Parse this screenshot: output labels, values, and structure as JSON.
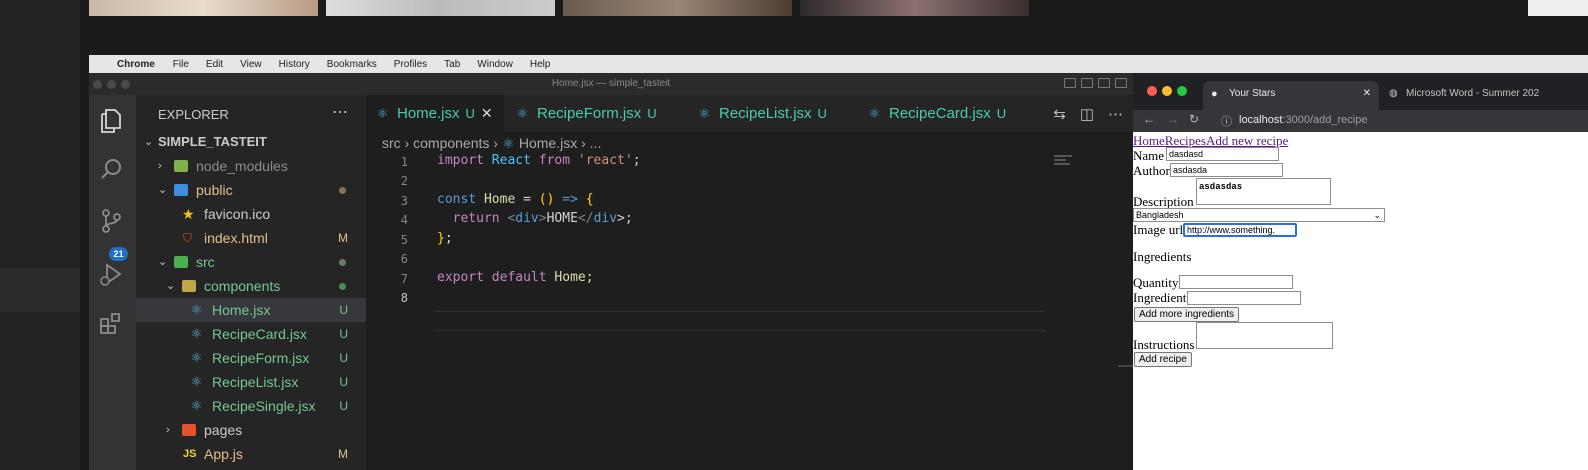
{
  "menubar": {
    "items": [
      "Chrome",
      "File",
      "Edit",
      "View",
      "History",
      "Bookmarks",
      "Profiles",
      "Tab",
      "Window",
      "Help"
    ]
  },
  "vscode": {
    "window_title": "Home.jsx — simple_tasteit",
    "scm_badge": "21",
    "explorer_title": "EXPLORER",
    "tree": [
      {
        "label": "SIMPLE_TASTEIT",
        "status": ""
      },
      {
        "label": "node_modules",
        "status": ""
      },
      {
        "label": "public",
        "status": ""
      },
      {
        "label": "favicon.ico",
        "status": ""
      },
      {
        "label": "index.html",
        "status": "M"
      },
      {
        "label": "src",
        "status": ""
      },
      {
        "label": "components",
        "status": ""
      },
      {
        "label": "Home.jsx",
        "status": "U"
      },
      {
        "label": "RecipeCard.jsx",
        "status": "U"
      },
      {
        "label": "RecipeForm.jsx",
        "status": "U"
      },
      {
        "label": "RecipeList.jsx",
        "status": "U"
      },
      {
        "label": "RecipeSingle.jsx",
        "status": "U"
      },
      {
        "label": "pages",
        "status": ""
      },
      {
        "label": "App.js",
        "status": "M"
      }
    ],
    "tabs": [
      {
        "label": "Home.jsx",
        "status": "U"
      },
      {
        "label": "RecipeForm.jsx",
        "status": "U"
      },
      {
        "label": "RecipeList.jsx",
        "status": "U"
      },
      {
        "label": "RecipeCard.jsx",
        "status": "U"
      }
    ],
    "breadcrumb": {
      "part1": "src",
      "part2": "components",
      "part3": "Home.jsx",
      "part4": "..."
    },
    "line_numbers": [
      "1",
      "2",
      "3",
      "4",
      "5",
      "6",
      "7",
      "8"
    ],
    "code": {
      "l1": [
        "import",
        " React ",
        "from",
        " 'react'",
        ";"
      ],
      "l3": [
        "const",
        " Home",
        " = ",
        "()",
        " =>",
        " {"
      ],
      "l4": [
        "return",
        " <",
        "div",
        ">",
        "HOME",
        "</",
        "div",
        ">;"
      ],
      "l5": [
        "}",
        ";"
      ],
      "l7": [
        "export",
        " default",
        " Home;"
      ]
    }
  },
  "browser": {
    "tab1": "Your Stars",
    "tab2": "Microsoft Word - Summer 202",
    "url_host": "localhost",
    "url_path": ":3000/add_recipe",
    "nav_links": [
      "Home",
      "Recipes",
      "Add new recipe"
    ],
    "form": {
      "name_label": "Name",
      "name_value": "dasdasd",
      "author_label": "Author",
      "author_value": "asdasda",
      "description_label": "Description",
      "description_value": "asdasdas",
      "country_value": "Bangladesh",
      "image_label": "Image url",
      "image_value": "http://www.something.",
      "ingredients_heading": "Ingredients",
      "quantity_label": "Quantity",
      "ingredient_label": "Ingredient",
      "add_more_button": "Add more ingredients",
      "instructions_label": "Instructions",
      "submit_button": "Add recipe"
    }
  },
  "colors": {
    "accent_teal": "#4ec9b0",
    "badge_blue": "#1f6fc5",
    "modified_orange": "#e2c08d"
  }
}
